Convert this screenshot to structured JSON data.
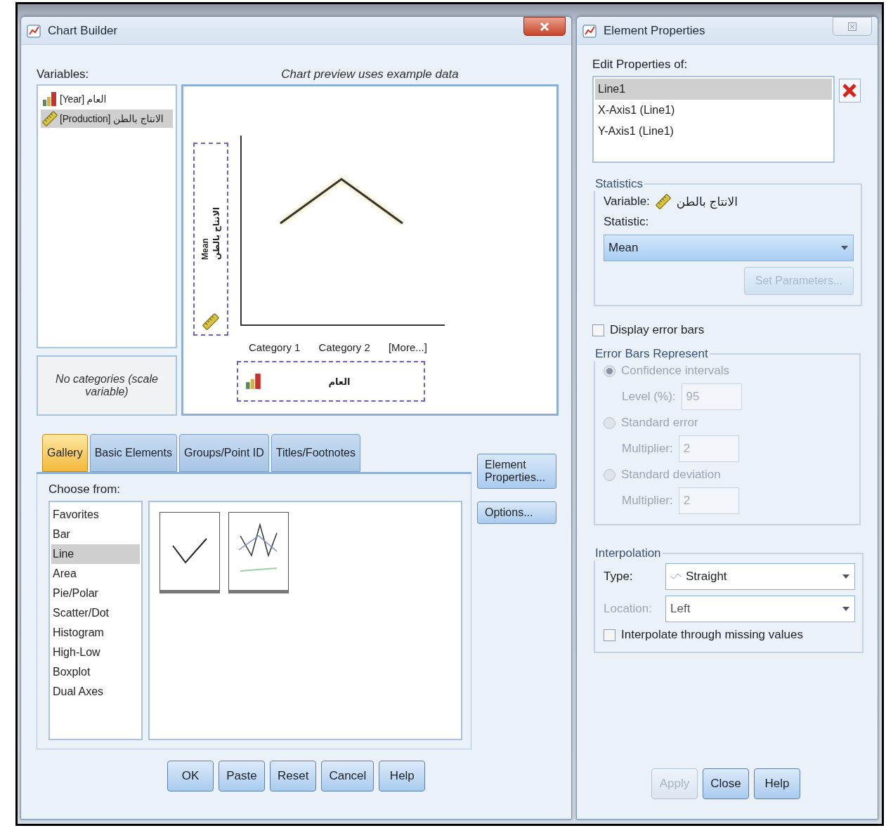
{
  "chart_builder": {
    "title": "Chart Builder",
    "variables_label": "Variables:",
    "variables": [
      {
        "name": "[Year] العام",
        "kind": "nominal",
        "selected": false
      },
      {
        "name": "[Production] الانتاج بالطن",
        "kind": "scale",
        "selected": true
      }
    ],
    "categories_note": "No categories (scale variable)",
    "preview_note": "Chart preview uses example data",
    "preview": {
      "y_axis": {
        "statistic": "Mean",
        "variable": "الانتاج بالطن",
        "kind": "scale"
      },
      "categories": [
        "Category 1",
        "Category 2",
        "[More...]"
      ],
      "x_axis": {
        "variable": "العام",
        "kind": "nominal"
      }
    },
    "tabs": [
      {
        "label": "Gallery",
        "selected": true
      },
      {
        "label": "Basic Elements",
        "selected": false
      },
      {
        "label": "Groups/Point ID",
        "selected": false
      },
      {
        "label": "Titles/Footnotes",
        "selected": false
      }
    ],
    "choose_from_label": "Choose from:",
    "chart_types": [
      {
        "label": "Favorites",
        "selected": false
      },
      {
        "label": "Bar",
        "selected": false
      },
      {
        "label": "Line",
        "selected": true
      },
      {
        "label": "Area",
        "selected": false
      },
      {
        "label": "Pie/Polar",
        "selected": false
      },
      {
        "label": "Scatter/Dot",
        "selected": false
      },
      {
        "label": "Histogram",
        "selected": false
      },
      {
        "label": "High-Low",
        "selected": false
      },
      {
        "label": "Boxplot",
        "selected": false
      },
      {
        "label": "Dual Axes",
        "selected": false
      }
    ],
    "gallery": [
      {
        "kind": "simple"
      },
      {
        "kind": "multiple"
      }
    ],
    "side_buttons": [
      "Element Properties...",
      "Options..."
    ],
    "buttons": [
      "OK",
      "Paste",
      "Reset",
      "Cancel",
      "Help"
    ]
  },
  "element_properties": {
    "title": "Element Properties",
    "edit_label": "Edit Properties of:",
    "elements": [
      {
        "label": "Line1",
        "selected": true
      },
      {
        "label": "X-Axis1 (Line1)",
        "selected": false
      },
      {
        "label": "Y-Axis1 (Line1)",
        "selected": false
      }
    ],
    "statistics": {
      "title": "Statistics",
      "variable_label": "Variable:",
      "variable": "الانتاج بالطن",
      "statistic_label": "Statistic:",
      "statistic": "Mean",
      "set_parameters": {
        "label": "Set Parameters...",
        "disabled": true
      }
    },
    "display_error_bars": {
      "label": "Display error bars",
      "checked": false
    },
    "error_bars": {
      "title": "Error Bars Represent",
      "disabled": true,
      "options": [
        {
          "label": "Confidence intervals",
          "selected": true,
          "field_label": "Level (%):",
          "value": "95"
        },
        {
          "label": "Standard error",
          "selected": false,
          "field_label": "Multiplier:",
          "value": "2"
        },
        {
          "label": "Standard deviation",
          "selected": false,
          "field_label": "Multiplier:",
          "value": "2"
        }
      ]
    },
    "interpolation": {
      "title": "Interpolation",
      "type_label": "Type:",
      "type": "Straight",
      "location_label": "Location:",
      "location": "Left",
      "location_disabled": true,
      "through_missing": {
        "label": "Interpolate through missing values",
        "checked": false
      }
    },
    "buttons": [
      {
        "label": "Apply",
        "disabled": true
      },
      {
        "label": "Close",
        "disabled": false
      },
      {
        "label": "Help",
        "disabled": false
      }
    ]
  }
}
